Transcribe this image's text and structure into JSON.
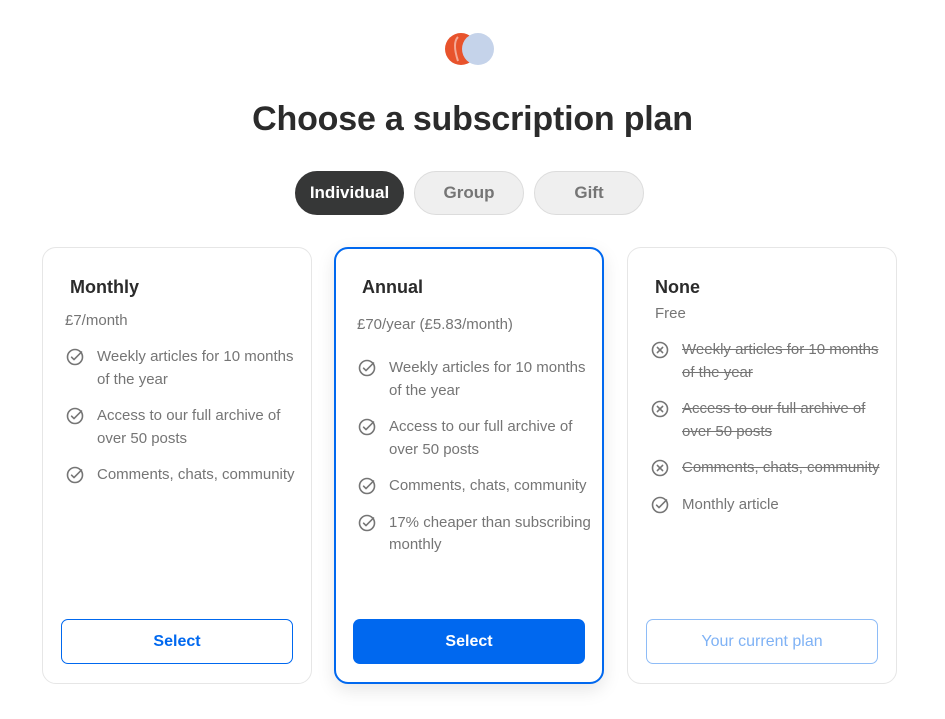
{
  "page": {
    "title": "Choose a subscription plan"
  },
  "colors": {
    "accent": "#0068ef",
    "dark": "#363737",
    "muted": "#757575",
    "logo_red": "#e8532c",
    "logo_blue": "#c5d3ea"
  },
  "tabs": [
    {
      "label": "Individual",
      "active": true
    },
    {
      "label": "Group",
      "active": false
    },
    {
      "label": "Gift",
      "active": false
    }
  ],
  "plans": {
    "monthly": {
      "name": "Monthly",
      "price": "£7/month",
      "features": [
        {
          "text": "Weekly articles for 10 months of the year",
          "icon": "check-circle-icon"
        },
        {
          "text": "Access to our full archive of over 50 posts",
          "icon": "check-circle-icon"
        },
        {
          "text": "Comments, chats, community",
          "icon": "check-circle-icon"
        }
      ],
      "button_label": "Select"
    },
    "annual": {
      "name": "Annual",
      "price": "£70/year (£5.83/month)",
      "features": [
        {
          "text": "Weekly articles for 10 months of the year",
          "icon": "check-circle-icon"
        },
        {
          "text": "Access to our full archive of over 50 posts",
          "icon": "check-circle-icon"
        },
        {
          "text": "Comments, chats, community",
          "icon": "check-circle-icon"
        },
        {
          "text": "17% cheaper than subscribing monthly",
          "icon": "check-circle-icon"
        }
      ],
      "button_label": "Select"
    },
    "none": {
      "name": "None",
      "price": "Free",
      "features": [
        {
          "text": "Weekly articles for 10 months of the year",
          "icon": "x-circle-icon"
        },
        {
          "text": "Access to our full archive of over 50 posts",
          "icon": "x-circle-icon"
        },
        {
          "text": "Comments, chats, community",
          "icon": "x-circle-icon"
        },
        {
          "text": "Monthly article",
          "icon": "check-circle-icon"
        }
      ],
      "button_label": "Your current plan"
    }
  }
}
